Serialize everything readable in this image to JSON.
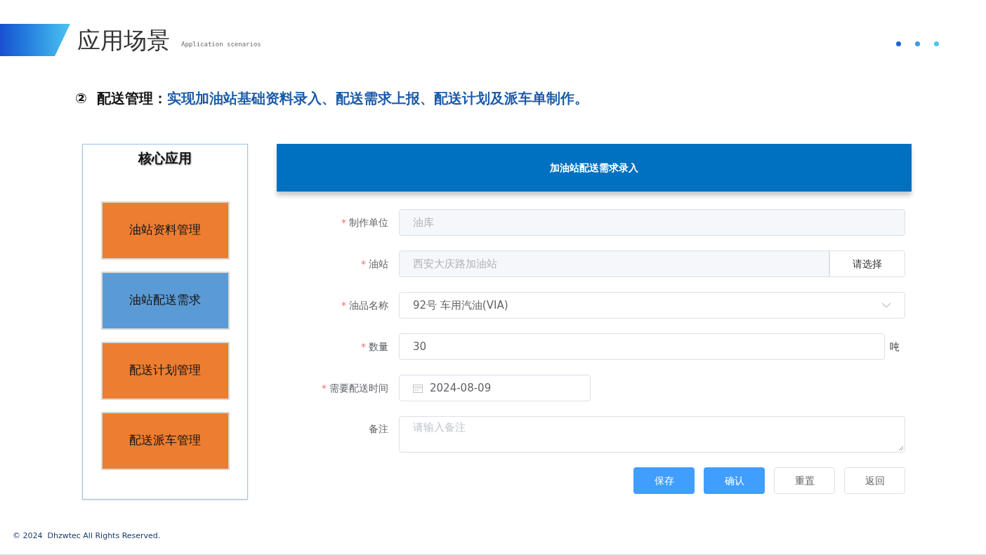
{
  "header": {
    "title": "应用场景",
    "subtitle": "Application scenarios"
  },
  "headline": {
    "number": "②",
    "label": "配送管理：",
    "text": "实现加油站基础资料录入、配送需求上报、配送计划及派车单制作。"
  },
  "core_panel": {
    "title": "核心应用",
    "items": [
      {
        "label": "油站资料管理",
        "selected": false
      },
      {
        "label": "油站配送需求",
        "selected": true
      },
      {
        "label": "配送计划管理",
        "selected": false
      },
      {
        "label": "配送派车管理",
        "selected": false
      }
    ]
  },
  "form": {
    "title": "加油站配送需求录入",
    "fields": [
      {
        "kind": "input",
        "required_mark": "*",
        "label": "制作单位",
        "value": "油库",
        "disabled": true
      },
      {
        "kind": "picker",
        "required_mark": "*",
        "label": "油站",
        "value": "西安大庆路加油站",
        "disabled": true,
        "button": "请选择"
      },
      {
        "kind": "select",
        "required_mark": "*",
        "label": "油品名称",
        "value": "92号 车用汽油(VIA)",
        "disabled": false
      },
      {
        "kind": "suffix",
        "required_mark": "*",
        "label": "数量",
        "value": "30",
        "disabled": false,
        "suffix": "吨"
      },
      {
        "kind": "date",
        "required_mark": "*",
        "label": "需要配送时间",
        "value": "2024-08-09",
        "disabled": false
      },
      {
        "kind": "textarea",
        "label": "备注",
        "placeholder": "请输入备注"
      }
    ],
    "buttons": [
      {
        "label": "保存",
        "primary": true
      },
      {
        "label": "确认",
        "primary": true
      },
      {
        "label": "重置",
        "primary": false
      },
      {
        "label": "返回",
        "primary": false
      }
    ]
  },
  "footer": "© 2024  Dhzwtec All Rights Reserved."
}
